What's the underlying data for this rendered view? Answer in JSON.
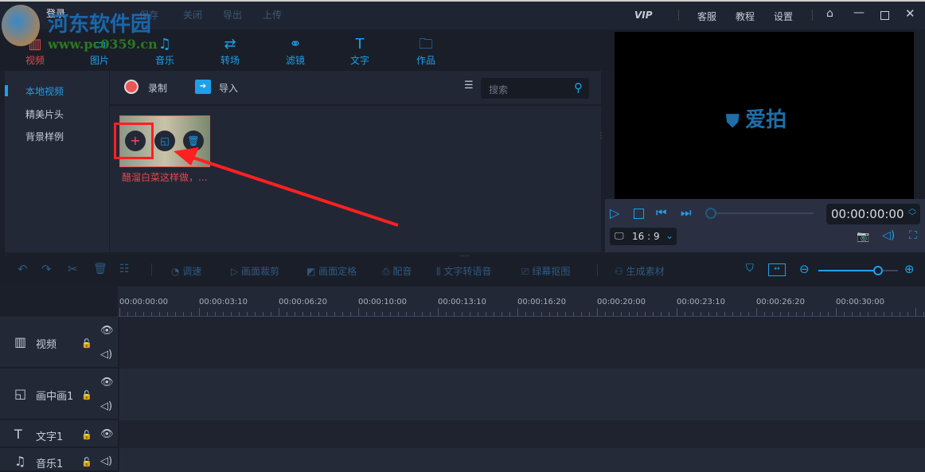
{
  "titlebar": {
    "login": "登录",
    "menu": [
      "保存",
      "关闭",
      "导出",
      "上传"
    ],
    "vip": "VIP",
    "right": [
      "客服",
      "教程",
      "设置"
    ]
  },
  "tabs": [
    {
      "label": "视频",
      "icon": "film-icon",
      "active": true
    },
    {
      "label": "图片",
      "icon": "image-icon"
    },
    {
      "label": "音乐",
      "icon": "music-icon"
    },
    {
      "label": "转场",
      "icon": "transition-icon"
    },
    {
      "label": "滤镜",
      "icon": "filter-icon"
    },
    {
      "label": "文字",
      "icon": "text-icon"
    },
    {
      "label": "作品",
      "icon": "folder-icon"
    }
  ],
  "sidebar": {
    "items": [
      "本地视频",
      "精美片头",
      "背景样例"
    ]
  },
  "media": {
    "record": "录制",
    "import": "导入",
    "search_placeholder": "搜索",
    "clip_title": "醋溜白菜这样做，..."
  },
  "preview": {
    "logo": "爱拍",
    "timecode": "00:00:00:00",
    "ratio": "16 : 9",
    "progress": 0
  },
  "toolbar": [
    "调速",
    "画面裁剪",
    "画面定格",
    "配音",
    "文字转语音",
    "绿幕抠图",
    "生成素材"
  ],
  "zoom_level": 0.75,
  "ruler": [
    "00:00:00:00",
    "00:00:03:10",
    "00:00:06:20",
    "00:00:10:00",
    "00:00:13:10",
    "00:00:16:20",
    "00:00:20:00",
    "00:00:23:10",
    "00:00:26:20",
    "00:00:30:00"
  ],
  "tracks": [
    {
      "label": "视频",
      "icon": "film-icon"
    },
    {
      "label": "画中画1",
      "icon": "pip-icon"
    },
    {
      "label": "文字1",
      "icon": "text-icon"
    },
    {
      "label": "音乐1",
      "icon": "music-icon"
    }
  ],
  "watermark": {
    "name": "河东软件园",
    "url": "www.pc0359.cn"
  },
  "colors": {
    "accent": "#1ea0e8",
    "active": "#e04b4b",
    "highlight": "#ff2020"
  }
}
